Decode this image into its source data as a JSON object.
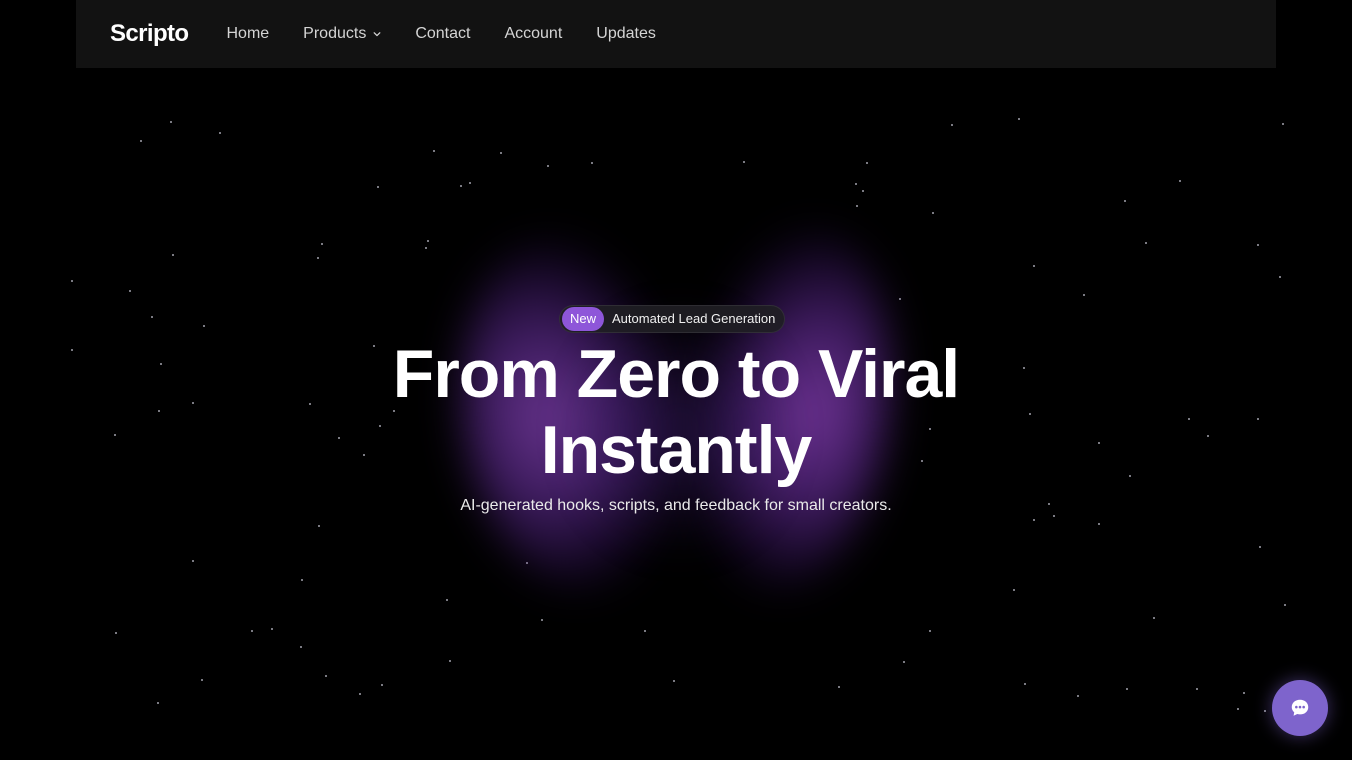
{
  "nav": {
    "logo": "Scripto",
    "items": [
      {
        "label": "Home"
      },
      {
        "label": "Products",
        "has_dropdown": true
      },
      {
        "label": "Contact"
      },
      {
        "label": "Account"
      },
      {
        "label": "Updates"
      }
    ]
  },
  "hero": {
    "badge_tag": "New",
    "badge_text": "Automated Lead Generation",
    "headline_line1": "From Zero to Viral",
    "headline_line2": "Instantly",
    "subheadline": "AI-generated hooks, scripts, and feedback for small creators."
  },
  "chat_widget": {
    "icon": "chat-bubble-icon"
  },
  "colors": {
    "background": "#000000",
    "navbar": "#121212",
    "accent": "#8e56d9",
    "chat_button": "#7e64cc"
  }
}
